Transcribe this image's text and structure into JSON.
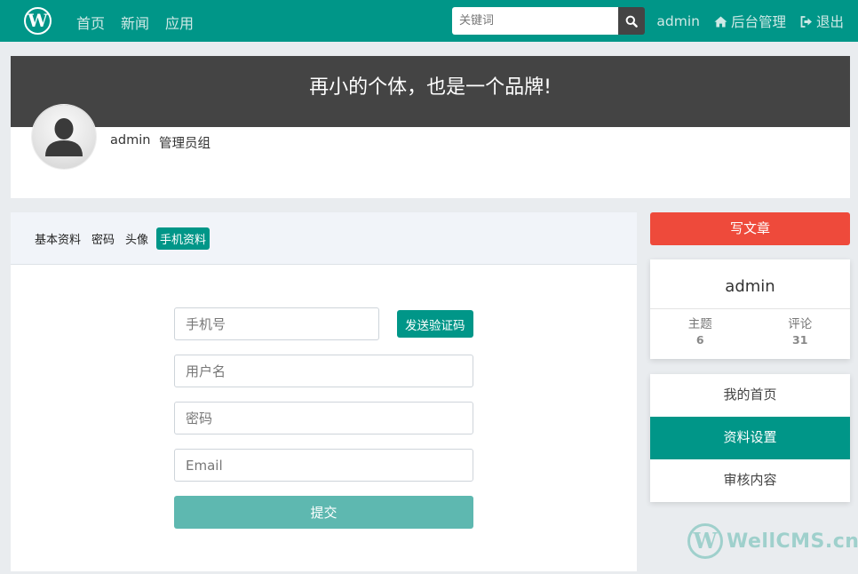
{
  "navbar": {
    "logo_letter": "W",
    "links": [
      "首页",
      "新闻",
      "应用"
    ],
    "search": {
      "placeholder": "关键词",
      "value": ""
    },
    "user": "admin",
    "admin_link": "后台管理",
    "logout_link": "退出"
  },
  "profile": {
    "banner_text": "再小的个体，也是一个品牌!",
    "username": "admin",
    "group": "管理员组"
  },
  "tabs": [
    "基本资料",
    "密码",
    "头像",
    "手机资料"
  ],
  "active_tab": "手机资料",
  "form": {
    "phone_placeholder": "手机号",
    "send_code_label": "发送验证码",
    "username_placeholder": "用户名",
    "password_placeholder": "密码",
    "email_placeholder": "Email",
    "submit_label": "提交"
  },
  "sidebar": {
    "write_label": "写文章",
    "user_name": "admin",
    "stats": [
      {
        "label": "主题",
        "value": "6"
      },
      {
        "label": "评论",
        "value": "31"
      }
    ],
    "menu": [
      "我的首页",
      "资料设置",
      "审核内容"
    ],
    "active_menu": "资料设置"
  },
  "watermark": {
    "letter": "W",
    "text": "WellCMS.cn"
  },
  "colors": {
    "brand": "#009688",
    "write_button": "#ee4a3b",
    "banner_bg": "#444444",
    "submit_button": "#5eb8b0"
  },
  "icons": {
    "search": "search-icon",
    "admin": "home-icon",
    "logout": "sign-out-icon",
    "avatar": "user-silhouette-icon"
  }
}
